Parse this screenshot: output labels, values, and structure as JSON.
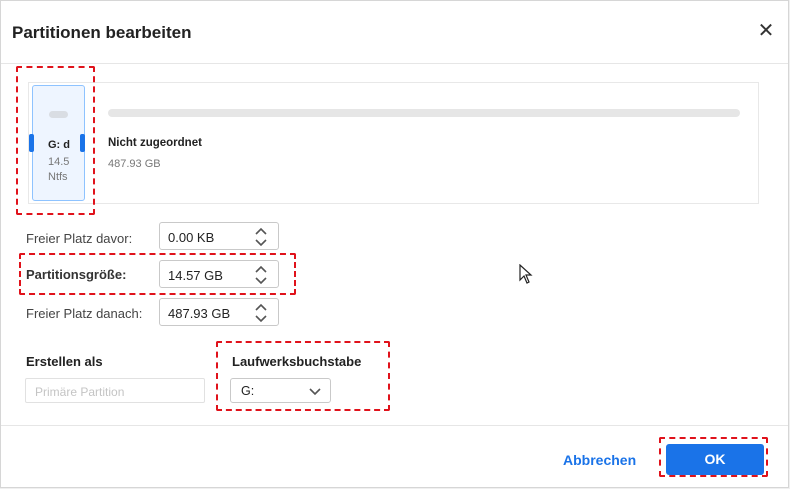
{
  "dialog": {
    "title": "Partitionen bearbeiten",
    "close_glyph": "✕"
  },
  "disk_map": {
    "partition": {
      "letter_label": "G: d",
      "size_label": "14.5",
      "fs_label": "Ntfs"
    },
    "unallocated": {
      "label": "Nicht zugeordnet",
      "size": "487.93 GB"
    }
  },
  "fields": {
    "free_before": {
      "label": "Freier Platz davor:",
      "value": "0.00 KB"
    },
    "partition_size": {
      "label": "Partitionsgröße:",
      "value": "14.57 GB"
    },
    "free_after": {
      "label": "Freier Platz danach:",
      "value": "487.93 GB"
    }
  },
  "create_as": {
    "label": "Erstellen als",
    "placeholder": "Primäre Partition"
  },
  "drive_letter": {
    "label": "Laufwerksbuchstabe",
    "selected": "G:"
  },
  "footer": {
    "cancel_label": "Abbrechen",
    "ok_label": "OK"
  },
  "colors": {
    "accent": "#1a73e8",
    "highlight": "#e0121b"
  }
}
